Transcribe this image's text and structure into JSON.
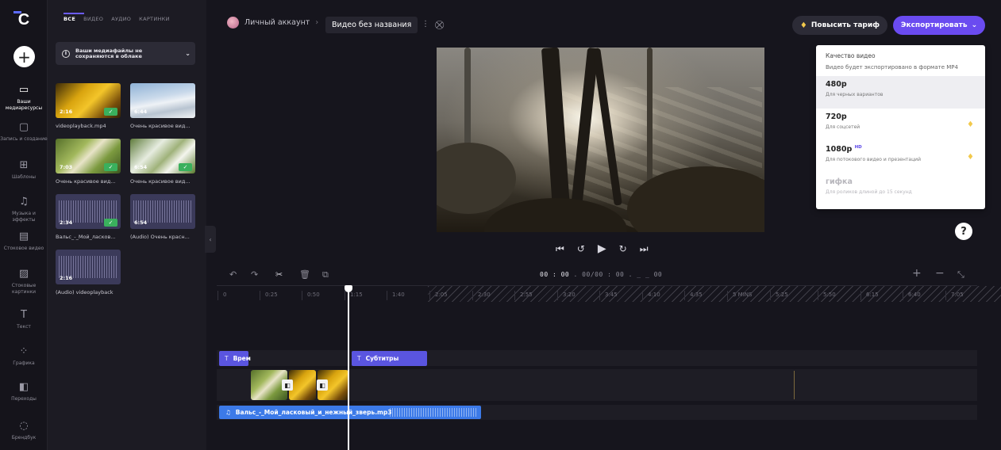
{
  "rail": {
    "logo": "C",
    "items": [
      {
        "icon": "folder",
        "label": "Ваши медиаресурсы",
        "active": true
      },
      {
        "icon": "camera",
        "label": "Запись и создание"
      },
      {
        "icon": "templates",
        "label": "Шаблоны"
      },
      {
        "icon": "music",
        "label": "Музыка и эффекты"
      },
      {
        "icon": "film",
        "label": "Стоковое видео"
      },
      {
        "icon": "image",
        "label": "Стоковые картинки"
      },
      {
        "icon": "text",
        "label": "Текст"
      },
      {
        "icon": "shapes",
        "label": "Графика"
      },
      {
        "icon": "transition",
        "label": "Переходы"
      },
      {
        "icon": "brand",
        "label": "Брендбук"
      }
    ]
  },
  "media": {
    "tabs": [
      "ВСЕ",
      "ВИДЕО",
      "АУДИО",
      "КАРТИНКИ"
    ],
    "notice": "Ваши медиафайлы не сохраняются в облаке",
    "items": [
      {
        "duration": "2:16",
        "label": "videoplayback.mp4",
        "checked": true
      },
      {
        "duration": "6:44",
        "label": "Очень красивое вид...",
        "checked": false
      },
      {
        "duration": "7:03",
        "label": "Очень красивое вид...",
        "checked": true
      },
      {
        "duration": "6:54",
        "label": "Очень красивое вид...",
        "checked": true
      },
      {
        "duration": "2:34",
        "label": "Вальс_-_Мой_ласков...",
        "checked": true
      },
      {
        "duration": "6:54",
        "label": "(Audio) Очень красн...",
        "checked": false
      },
      {
        "duration": "2:16",
        "label": "(Audio) videoplayback",
        "checked": false
      }
    ]
  },
  "header": {
    "account": "Личный аккаунт",
    "separator": "›",
    "project_title": "Видео без названия",
    "upgrade_label": "Повысить тариф",
    "export_label": "Экспортировать"
  },
  "export_menu": {
    "heading": "Качество видео",
    "subtitle": "Видео будет экспортировано в формате MP4",
    "options": [
      {
        "res": "480p",
        "desc": "Для черных вариантов",
        "selected": true,
        "premium": false
      },
      {
        "res": "720p",
        "desc": "Для соцсетей",
        "premium": true
      },
      {
        "res": "1080p",
        "badge": "HD",
        "desc": "Для потокового видео и презентаций",
        "premium": true
      },
      {
        "res": "гифка",
        "desc": "Для роликов длиной до 15 секунд",
        "disabled": true
      }
    ]
  },
  "help": "?",
  "timeline": {
    "timecode_main": "00 : 00",
    "timecode_frames": ". 00/00 : 00",
    "timecode_rest": ". _ _ 00",
    "ticks": [
      "0",
      "0:25",
      "0:50",
      "1:15",
      "1:40",
      "2:05",
      "2:30",
      "2:55",
      "3:20",
      "3:45",
      "4:10",
      "4:35",
      "5 MINS",
      "5:25",
      "5:50",
      "6:15",
      "6:40",
      "7:05"
    ],
    "text_clips": [
      "Врем",
      "Субтитры"
    ],
    "audio_clip": "Вальс_-_Мой_ласковый_и_нежный_зверь.mp3"
  },
  "colors": {
    "accent": "#6a4bf0",
    "text_clip": "#5a55e0",
    "audio_clip": "#3c7ae8",
    "premium": "#f2c94c"
  }
}
